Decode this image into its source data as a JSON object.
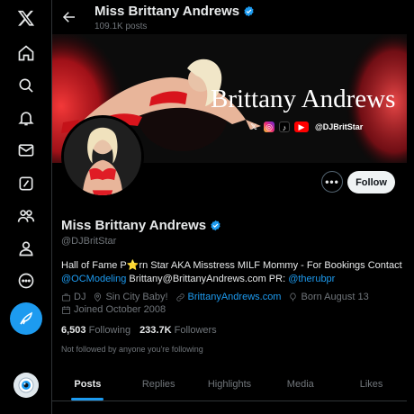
{
  "nav": {
    "items": [
      {
        "name": "x-logo-icon",
        "label": "X"
      },
      {
        "name": "home-icon",
        "label": "Home"
      },
      {
        "name": "search-icon",
        "label": "Explore"
      },
      {
        "name": "bell-icon",
        "label": "Notifications"
      },
      {
        "name": "mail-icon",
        "label": "Messages"
      },
      {
        "name": "grok-icon",
        "label": "Grok"
      },
      {
        "name": "communities-icon",
        "label": "Communities"
      },
      {
        "name": "profile-icon",
        "label": "Profile"
      },
      {
        "name": "more-icon",
        "label": "More"
      }
    ],
    "post_icon": "feather-icon"
  },
  "header": {
    "name": "Miss Brittany Andrews",
    "posts_count": "109.1K posts",
    "back_icon": "arrow-left-icon"
  },
  "banner": {
    "title": "Brittany Andrews",
    "socials": [
      "X",
      "Instagram",
      "TikTok",
      "YouTube"
    ],
    "handle": "@DJBritStar"
  },
  "profile": {
    "display_name": "Miss Brittany Andrews",
    "verified": true,
    "handle": "@DJBritStar",
    "bio_parts": {
      "p1": "Hall of Fame P",
      "star": "⭐",
      "p2": "rn Star AKA Misstress MILF Mommy - For Bookings Contact",
      "link1": "@OCModeling",
      "p3": " Brittany@BrittanyAndrews.com PR: ",
      "link2": "@therubpr"
    },
    "category": "DJ",
    "location": "Sin City Baby!",
    "website": "BrittanyAndrews.com",
    "birthday": "Born August 13",
    "joined": "Joined October 2008",
    "following_count": "6,503",
    "following_label": "Following",
    "followers_count": "233.7K",
    "followers_label": "Followers",
    "not_followed": "Not followed by anyone you're following"
  },
  "actions": {
    "more_label": "•••",
    "follow_label": "Follow"
  },
  "tabs": [
    {
      "label": "Posts",
      "active": true
    },
    {
      "label": "Replies",
      "active": false
    },
    {
      "label": "Highlights",
      "active": false
    },
    {
      "label": "Media",
      "active": false
    },
    {
      "label": "Likes",
      "active": false
    }
  ],
  "colors": {
    "accent": "#1d9bf0",
    "background": "#000000",
    "text": "#e7e9ea",
    "muted": "#71767b",
    "banner_red": "#e4202a"
  }
}
